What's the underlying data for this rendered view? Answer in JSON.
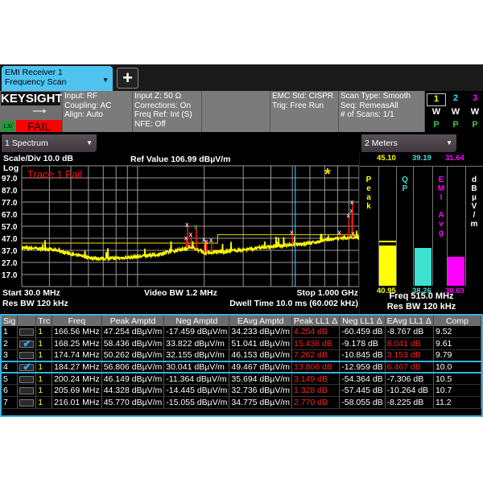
{
  "tab": {
    "title_line1": "EMI Receiver 1",
    "title_line2": "Frequency Scan",
    "dropdown_icon": "triangle-down",
    "add_icon": "plus"
  },
  "info": {
    "brand": "KEYSIGHT",
    "lxi": "LXI",
    "status": "FAIL",
    "col1": [
      "Input: RF",
      "Coupling: AC",
      "Align: Auto"
    ],
    "col2": [
      "Input Z: 50 Ω",
      "Corrections: On",
      "Freq Ref: Int (S)",
      "NFE: Off"
    ],
    "col4": [
      "EMC Std: CISPR",
      "Trig: Free Run"
    ],
    "col5": [
      "Scan Type: Smooth",
      "Seq: RemeasAll",
      "# of Scans: 1/1"
    ],
    "traces": [
      {
        "num": "1",
        "mode": "W",
        "det": "P",
        "color": "#ffff00"
      },
      {
        "num": "2",
        "mode": "W",
        "det": "P",
        "color": "#33e0ff"
      },
      {
        "num": "3",
        "mode": "W",
        "det": "P",
        "color": "#ff00ff"
      }
    ]
  },
  "windows": {
    "spectrum": "1 Spectrum",
    "meters": "2 Meters"
  },
  "spectrum": {
    "scale_div": "Scale/Div 10.0 dB",
    "ref_value": "Ref Value 106.99 dBµV/m",
    "log": "Log",
    "fail_text": "Trace 1 Fail",
    "start": "Start 30.0 MHz",
    "res_bw": "Res BW 120 kHz",
    "video_bw": "Video BW 1.2 MHz",
    "stop": "Stop 1.000 GHz",
    "dwell": "Dwell Time 10.0 ms (60.002 kHz)",
    "y_ticks": [
      "97.0",
      "87.0",
      "77.0",
      "67.0",
      "57.0",
      "47.0",
      "37.0",
      "27.0",
      "17.0"
    ],
    "ref_level": 106.99,
    "scale": 10,
    "freq_range_mhz": [
      30,
      1000
    ],
    "x_scale": "log",
    "meter_freq_mhz": 515,
    "trace_color": "#ffff00",
    "limit_line": [
      {
        "from": 30,
        "to": 230,
        "level": 43
      },
      {
        "from": 230,
        "to": 1000,
        "level": 50
      }
    ],
    "trace_baseline": [
      [
        30,
        39
      ],
      [
        40,
        38
      ],
      [
        50,
        34
      ],
      [
        60,
        31
      ],
      [
        70,
        30
      ],
      [
        90,
        31
      ],
      [
        120,
        33
      ],
      [
        160,
        38
      ],
      [
        175,
        40
      ],
      [
        200,
        35
      ],
      [
        250,
        36
      ],
      [
        400,
        40
      ],
      [
        600,
        43
      ],
      [
        800,
        47
      ],
      [
        1000,
        48
      ]
    ],
    "markers": [
      [
        166.56,
        47.254
      ],
      [
        168.25,
        58.436
      ],
      [
        174.74,
        50.262
      ],
      [
        184.27,
        56.806
      ],
      [
        200.24,
        46.149
      ],
      [
        205.69,
        44.328
      ],
      [
        216.01,
        45.77
      ],
      [
        500,
        52
      ],
      [
        820,
        52
      ],
      [
        900,
        66
      ],
      [
        930,
        70
      ],
      [
        935,
        77
      ],
      [
        945,
        51
      ]
    ],
    "selected_marker": 3
  },
  "meters": {
    "items": [
      {
        "name": "Peak",
        "max": "45.10",
        "current": "40.95",
        "max_val": 45.1,
        "cur_val": 40.95,
        "color": "#ffff00"
      },
      {
        "name": "QP",
        "max": "39.19",
        "current": "38.26",
        "max_val": 39.19,
        "cur_val": 38.26,
        "color": "#40e0d0"
      },
      {
        "name": "EMI Avg",
        "max": "31.64",
        "current": "30.69",
        "max_val": 31.64,
        "cur_val": 30.69,
        "color": "#ff00ff"
      }
    ],
    "unit": "dBµV/m",
    "freq": "Freq 515.0 MHz",
    "res_bw": "Res BW 120 kHz"
  },
  "table": {
    "headers": [
      "Sig",
      "",
      "Trc",
      "Freq",
      "Peak Amptd",
      "Neg Amptd",
      "EAvg Amptd",
      "Peak LL1 Δ",
      "Neg LL1 Δ",
      "EAvg LL1 Δ",
      "Comp"
    ],
    "rows": [
      {
        "sig": "1",
        "checked": false,
        "trc": "1",
        "freq": "166.56 MHz",
        "peak": "47.254 dBµV/m",
        "neg": "-17.459 dBµV/m",
        "eavg": "34.233 dBµV/m",
        "peak_d": "4.254 dB",
        "neg_d": "-60.459 dB",
        "eavg_d": "-8.767 dB",
        "comp": "9.52",
        "peak_fail": true,
        "eavg_fail": false
      },
      {
        "sig": "2",
        "checked": true,
        "trc": "1",
        "freq": "168.25 MHz",
        "peak": "58.436 dBµV/m",
        "neg": "33.822 dBµV/m",
        "eavg": "51.041 dBµV/m",
        "peak_d": "15.436 dB",
        "neg_d": "-9.178 dB",
        "eavg_d": "8.041 dB",
        "comp": "9.61",
        "peak_fail": true,
        "eavg_fail": true
      },
      {
        "sig": "3",
        "checked": false,
        "trc": "1",
        "freq": "174.74 MHz",
        "peak": "50.262 dBµV/m",
        "neg": "32.155 dBµV/m",
        "eavg": "46.153 dBµV/m",
        "peak_d": "7.262 dB",
        "neg_d": "-10.845 dB",
        "eavg_d": "3.153 dB",
        "comp": "9.79",
        "peak_fail": true,
        "eavg_fail": true
      },
      {
        "sig": "4",
        "checked": true,
        "trc": "1",
        "freq": "184.27 MHz",
        "peak": "56.806 dBµV/m",
        "neg": "30.041 dBµV/m",
        "eavg": "49.467 dBµV/m",
        "peak_d": "13.806 dB",
        "neg_d": "-12.959 dB",
        "eavg_d": "6.467 dB",
        "comp": "10.0",
        "peak_fail": true,
        "eavg_fail": true,
        "selected": true
      },
      {
        "sig": "5",
        "checked": false,
        "trc": "1",
        "freq": "200.24 MHz",
        "peak": "46.149 dBµV/m",
        "neg": "-11.364 dBµV/m",
        "eavg": "35.694 dBµV/m",
        "peak_d": "3.149 dB",
        "neg_d": "-54.364 dB",
        "eavg_d": "-7.306 dB",
        "comp": "10.5",
        "peak_fail": true,
        "eavg_fail": false
      },
      {
        "sig": "6",
        "checked": false,
        "trc": "1",
        "freq": "205.69 MHz",
        "peak": "44.328 dBµV/m",
        "neg": "-14.445 dBµV/m",
        "eavg": "32.736 dBµV/m",
        "peak_d": "1.328 dB",
        "neg_d": "-57.445 dB",
        "eavg_d": "-10.264 dB",
        "comp": "10.7",
        "peak_fail": true,
        "eavg_fail": false
      },
      {
        "sig": "7",
        "checked": false,
        "trc": "1",
        "freq": "216.01 MHz",
        "peak": "45.770 dBµV/m",
        "neg": "-15.055 dBµV/m",
        "eavg": "34.775 dBµV/m",
        "peak_d": "2.770 dB",
        "neg_d": "-58.055 dB",
        "eavg_d": "-8.225 dB",
        "comp": "11.2",
        "peak_fail": true,
        "eavg_fail": false
      }
    ]
  }
}
